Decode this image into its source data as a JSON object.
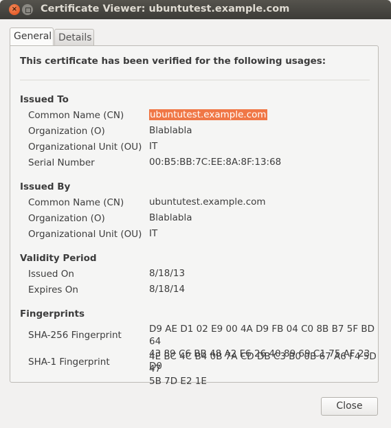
{
  "window": {
    "title": "Certificate Viewer: ubuntutest.example.com",
    "close_icon": "×"
  },
  "tabs": [
    {
      "label": "General",
      "active": true
    },
    {
      "label": "Details",
      "active": false
    }
  ],
  "heading": "This certificate has been verified for the following usages:",
  "issued_to": {
    "title": "Issued To",
    "rows": [
      {
        "label": "Common Name (CN)",
        "value": "ubuntutest.example.com"
      },
      {
        "label": "Organization (O)",
        "value": "Blablabla"
      },
      {
        "label": "Organizational Unit (OU)",
        "value": "IT"
      },
      {
        "label": "Serial Number",
        "value": "00:B5:BB:7C:EE:8A:8F:13:68"
      }
    ]
  },
  "issued_by": {
    "title": "Issued By",
    "rows": [
      {
        "label": "Common Name (CN)",
        "value": "ubuntutest.example.com"
      },
      {
        "label": "Organization (O)",
        "value": "Blablabla"
      },
      {
        "label": "Organizational Unit (OU)",
        "value": "IT"
      }
    ]
  },
  "validity": {
    "title": "Validity Period",
    "rows": [
      {
        "label": "Issued On",
        "value": "8/18/13"
      },
      {
        "label": "Expires On",
        "value": "8/18/14"
      }
    ]
  },
  "fingerprints": {
    "title": "Fingerprints",
    "rows": [
      {
        "label": "SHA-256 Fingerprint",
        "line1": "D9 AE D1 02 E9 00 4A D9 FB 04 C0 8B B7 5F BD 64",
        "line2": "43 89 C6 BB 48 A2 E6 26 40 89 69 C1 75 AF 23 D0"
      },
      {
        "label": "SHA-1 Fingerprint",
        "line1": "4E BC 4C B4 0B 7A CD DB C3 B0 0B 67 A6 F4 5D 47",
        "line2": "5B 7D E2 1E"
      }
    ]
  },
  "buttons": {
    "close": "Close"
  },
  "colors": {
    "selection": "#f07746",
    "titlebar": "#3c3b37"
  }
}
